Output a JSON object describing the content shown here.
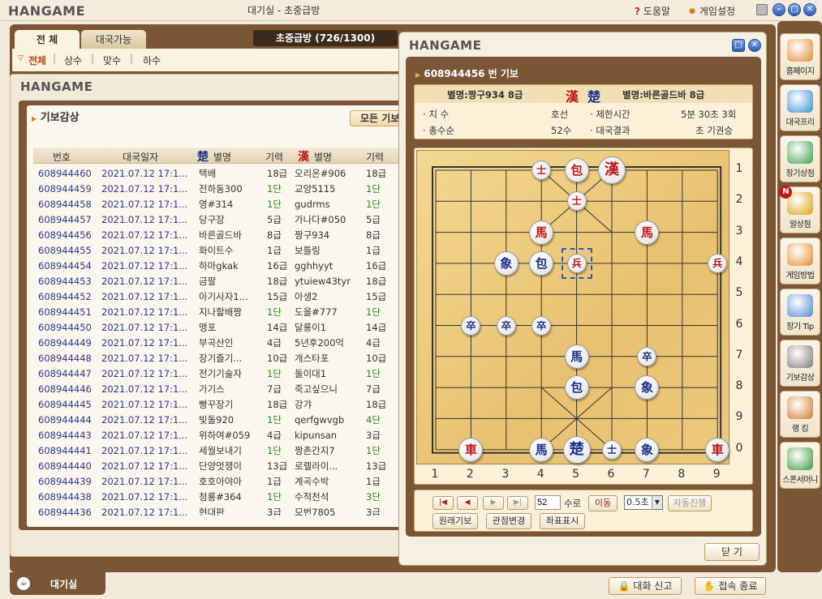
{
  "topbar": {
    "logo": "HANGAME",
    "title": "대기실 - 초중급방",
    "help_label": "도움말",
    "settings_label": "게임설정"
  },
  "lobby": {
    "tabs": [
      "전 체",
      "대국가능"
    ],
    "room_title": "초중급방 (726/1300)",
    "filters": [
      "전체",
      "상수",
      "맞수",
      "하수"
    ]
  },
  "records_window": {
    "logo": "HANGAME",
    "section_title": "기보감상",
    "filter_tab": "모든 기보",
    "headers": [
      "번호",
      "대국일자",
      "별명",
      "기력",
      "별명",
      "기력"
    ],
    "han_symbol": "漢",
    "cho_symbol": "楚",
    "rows": [
      [
        "608944460",
        "2021.07.12 17:1...",
        "택배",
        "18급",
        "오리온#906",
        "18급"
      ],
      [
        "608944459",
        "2021.07.12 17:1...",
        "전하동300",
        "1단",
        "교양5115",
        "1단"
      ],
      [
        "608944458",
        "2021.07.12 17:1...",
        "영#314",
        "1단",
        "gudrms",
        "1단"
      ],
      [
        "608944457",
        "2021.07.12 17:1...",
        "당구장",
        "5급",
        "가나다#050",
        "5급"
      ],
      [
        "608944456",
        "2021.07.12 17:1...",
        "바른골드바",
        "8급",
        "짱구934",
        "8급"
      ],
      [
        "608944455",
        "2021.07.12 17:1...",
        "화이트수",
        "1급",
        "보틀링",
        "1급"
      ],
      [
        "608944454",
        "2021.07.12 17:1...",
        "하마gkak",
        "16급",
        "gghhyyt",
        "16급"
      ],
      [
        "608944453",
        "2021.07.12 17:1...",
        "금팔",
        "18급",
        "ytuiew43tyr",
        "18급"
      ],
      [
        "608944452",
        "2021.07.12 17:1...",
        "아기사자1...",
        "15급",
        "아생2",
        "15급"
      ],
      [
        "608944451",
        "2021.07.12 17:1...",
        "지나할배짱",
        "1단",
        "도올#777",
        "1단"
      ],
      [
        "608944450",
        "2021.07.12 17:1...",
        "맹포",
        "14급",
        "달룡이1",
        "14급"
      ],
      [
        "608944449",
        "2021.07.12 17:1...",
        "부곡산인",
        "4급",
        "5년후200억",
        "4급"
      ],
      [
        "608944448",
        "2021.07.12 17:1...",
        "장기즐기...",
        "10급",
        "개스타포",
        "10급"
      ],
      [
        "608944447",
        "2021.07.12 17:1...",
        "전기기술자",
        "1단",
        "돌이대1",
        "1단"
      ],
      [
        "608944446",
        "2021.07.12 17:1...",
        "가기스",
        "7급",
        "죽고싶으니",
        "7급"
      ],
      [
        "608944445",
        "2021.07.12 17:1...",
        "빵꾸장기",
        "18급",
        "강갸",
        "18급"
      ],
      [
        "608944444",
        "2021.07.12 17:1...",
        "빛돌920",
        "1단",
        "qerfgwvgb",
        "4단"
      ],
      [
        "608944443",
        "2021.07.12 17:1...",
        "위하여#059",
        "4급",
        "kipunsan",
        "3급"
      ],
      [
        "608944441",
        "2021.07.12 17:1...",
        "세월보내기",
        "1단",
        "짱촌간지7",
        "1단"
      ],
      [
        "608944440",
        "2021.07.12 17:1...",
        "단양멋쟁이",
        "13급",
        "로렐라이...",
        "13급"
      ],
      [
        "608944439",
        "2021.07.12 17:1...",
        "호호아야아",
        "1급",
        "계곡수박",
        "1급"
      ],
      [
        "608944438",
        "2021.07.12 17:1...",
        "청룡#364",
        "1단",
        "수적천석",
        "3단"
      ],
      [
        "608944436",
        "2021.07.12 17:1...",
        "현대판",
        "3급",
        "모번7805",
        "3급"
      ]
    ]
  },
  "dialog": {
    "logo": "HANGAME",
    "record_title": "608944456 번 기보",
    "han_player": "별명:짱구934 8급",
    "cho_player": "별명:바른골드바 8급",
    "han_symbol": "漢",
    "cho_symbol": "楚",
    "info": {
      "turn_label": "치 수",
      "turn_value": "호선",
      "limit_label": "제한시간",
      "limit_value": "5분 30초 3회",
      "moves_label": "총수순",
      "moves_value": "52수",
      "result_label": "대국결과",
      "result_value": "초 기권승"
    },
    "col_labels": [
      "1",
      "2",
      "3",
      "4",
      "5",
      "6",
      "7",
      "8",
      "9"
    ],
    "row_labels": [
      "1",
      "2",
      "3",
      "4",
      "5",
      "6",
      "7",
      "8",
      "9",
      "0"
    ],
    "pieces": [
      {
        "t": "士",
        "c": "red",
        "col": 4,
        "row": 1,
        "s": "small"
      },
      {
        "t": "包",
        "c": "red",
        "col": 5,
        "row": 1,
        "s": ""
      },
      {
        "t": "漢",
        "c": "red",
        "col": 6,
        "row": 1,
        "s": "large"
      },
      {
        "t": "士",
        "c": "red",
        "col": 5,
        "row": 2,
        "s": "small"
      },
      {
        "t": "馬",
        "c": "red",
        "col": 4,
        "row": 3,
        "s": ""
      },
      {
        "t": "馬",
        "c": "red",
        "col": 7,
        "row": 3,
        "s": ""
      },
      {
        "t": "兵",
        "c": "red",
        "col": 5,
        "row": 4,
        "s": "small"
      },
      {
        "t": "兵",
        "c": "red",
        "col": 9,
        "row": 4,
        "s": "small"
      },
      {
        "t": "車",
        "c": "red",
        "col": 2,
        "row": 10,
        "s": ""
      },
      {
        "t": "車",
        "c": "red",
        "col": 9,
        "row": 10,
        "s": ""
      },
      {
        "t": "象",
        "c": "blue",
        "col": 3,
        "row": 4,
        "s": ""
      },
      {
        "t": "包",
        "c": "blue",
        "col": 4,
        "row": 4,
        "s": ""
      },
      {
        "t": "卒",
        "c": "blue",
        "col": 2,
        "row": 6,
        "s": "small"
      },
      {
        "t": "卒",
        "c": "blue",
        "col": 3,
        "row": 6,
        "s": "small"
      },
      {
        "t": "卒",
        "c": "blue",
        "col": 4,
        "row": 6,
        "s": "small"
      },
      {
        "t": "馬",
        "c": "blue",
        "col": 5,
        "row": 7,
        "s": ""
      },
      {
        "t": "卒",
        "c": "blue",
        "col": 7,
        "row": 7,
        "s": "small"
      },
      {
        "t": "包",
        "c": "blue",
        "col": 5,
        "row": 8,
        "s": ""
      },
      {
        "t": "象",
        "c": "blue",
        "col": 7,
        "row": 8,
        "s": ""
      },
      {
        "t": "馬",
        "c": "blue",
        "col": 4,
        "row": 10,
        "s": ""
      },
      {
        "t": "楚",
        "c": "blue",
        "col": 5,
        "row": 10,
        "s": "large"
      },
      {
        "t": "士",
        "c": "blue",
        "col": 6,
        "row": 10,
        "s": "small"
      },
      {
        "t": "象",
        "c": "blue",
        "col": 7,
        "row": 10,
        "s": ""
      }
    ],
    "move_value": "52",
    "move_unit": "수로",
    "move_button": "이동",
    "speed_value": "0.5초",
    "auto_button": "자동진행",
    "original_button": "원래기보",
    "view_button": "관점변경",
    "coord_button": "좌표표시",
    "close_button": "닫 기"
  },
  "sidebar": [
    "홈페이지",
    "대국프리",
    "장기상점",
    "알상점",
    "게임방법",
    "장기 Tip",
    "기보감상",
    "랭 킹",
    "스폰서머니"
  ],
  "sidebar_badge": "N",
  "bottom": {
    "tab": "대기실",
    "report_button": "대화 신고",
    "exit_button": "접속 종료"
  },
  "colors": {
    "panel": "#7a5636",
    "red_piece": "#c01818",
    "blue_piece": "#1a2f8c",
    "green_rank": "#2a8a1a"
  }
}
